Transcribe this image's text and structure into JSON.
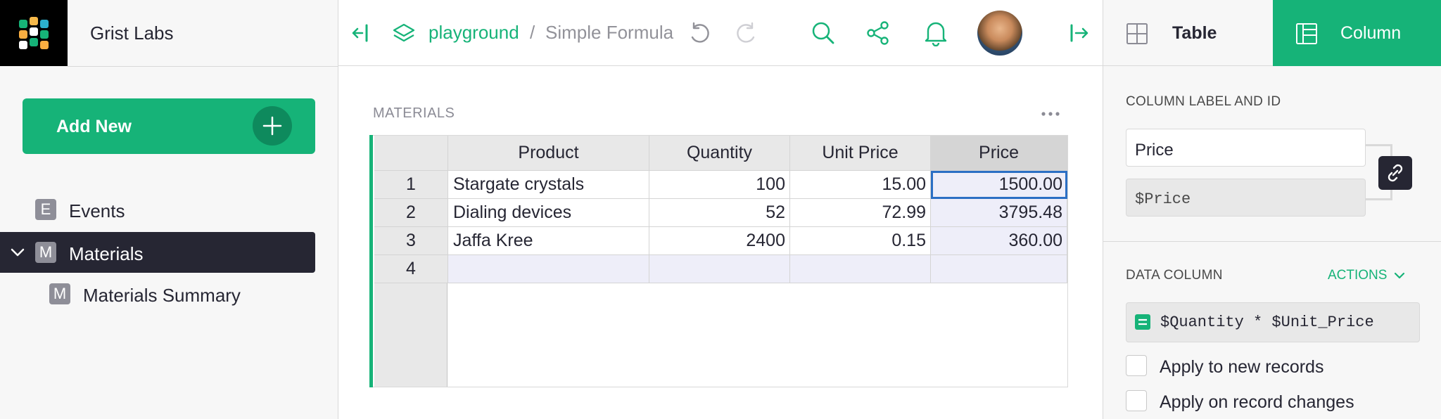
{
  "org": {
    "name": "Grist Labs"
  },
  "sidebar": {
    "add_new_label": "Add New",
    "pages": [
      {
        "badge": "E",
        "label": "Events"
      },
      {
        "badge": "M",
        "label": "Materials",
        "selected": true
      },
      {
        "badge": "M",
        "label": "Materials Summary"
      }
    ]
  },
  "header": {
    "workspace": "playground",
    "separator": "/",
    "document": "Simple Formula"
  },
  "widget": {
    "title": "MATERIALS",
    "columns": [
      "Product",
      "Quantity",
      "Unit Price",
      "Price"
    ],
    "rows": [
      {
        "row_number": "1",
        "product": "Stargate crystals",
        "quantity": "100",
        "unit_price": "15.00",
        "price": "1500.00"
      },
      {
        "row_number": "2",
        "product": "Dialing devices",
        "quantity": "52",
        "unit_price": "72.99",
        "price": "3795.48"
      },
      {
        "row_number": "3",
        "product": "Jaffa Kree",
        "quantity": "2400",
        "unit_price": "0.15",
        "price": "360.00"
      }
    ],
    "new_row_number": "4"
  },
  "right_panel": {
    "tab_table": "Table",
    "tab_column": "Column",
    "column_label_section": "COLUMN LABEL AND ID",
    "column_label": "Price",
    "column_id": "$Price",
    "data_column_section": "DATA COLUMN",
    "actions_label": "ACTIONS",
    "formula": "$Quantity * $Unit_Price",
    "apply_new_records": "Apply to new records",
    "apply_record_changes": "Apply on record changes"
  },
  "colors": {
    "accent": "#16b378",
    "selected_page": "#262633",
    "cursor": "#2b6fc4"
  }
}
